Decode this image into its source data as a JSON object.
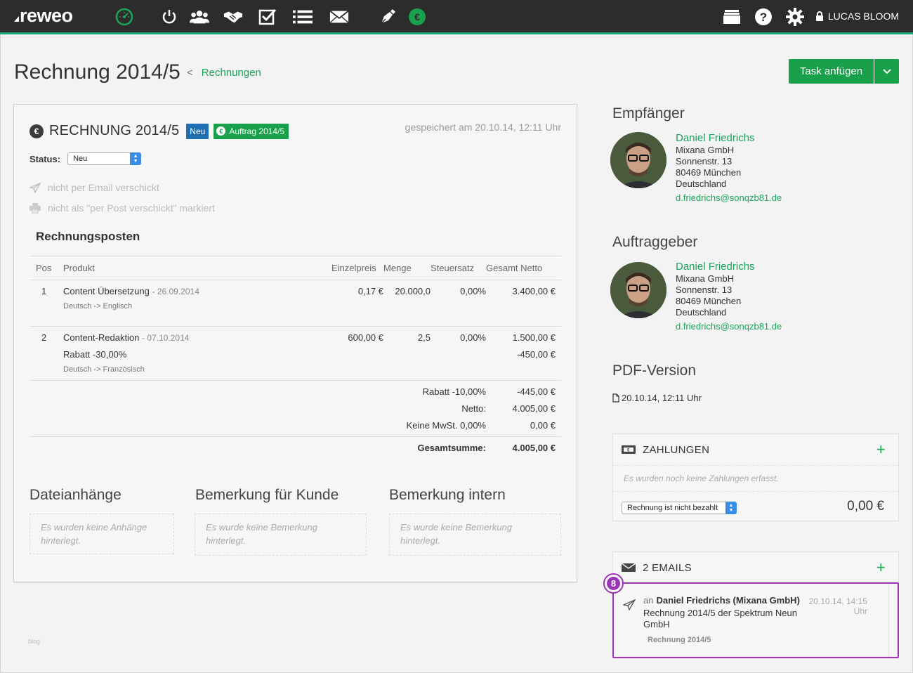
{
  "app": {
    "logo": "reweo",
    "user": "LUCAS BLOOM"
  },
  "nav": {
    "icons": [
      "dashboard-icon",
      "power-icon",
      "contacts-icon",
      "deals-icon",
      "tasks-icon",
      "list-icon",
      "mail-icon",
      "pen-icon",
      "finance-icon"
    ],
    "right_icons": [
      "archive-icon",
      "help-icon",
      "settings-icon",
      "lock-icon"
    ],
    "accent": "#1aa878"
  },
  "header": {
    "title": "Rechnung 2014/5",
    "breadcrumb": "Rechnungen",
    "task_button": "Task anfügen"
  },
  "invoice": {
    "title": "RECHNUNG 2014/5",
    "badge_status": "Neu",
    "badge_order": "Auftrag 2014/5",
    "saved": "gespeichert am 20.10.14, 12:11 Uhr",
    "status_label": "Status:",
    "status_value": "Neu",
    "email_state": "nicht per Email verschickt",
    "post_state": "nicht als \"per Post verschickt\" markiert",
    "section_title": "Rechnungsposten",
    "columns": [
      "Pos",
      "Produkt",
      "Einzelpreis",
      "Menge",
      "Steuersatz",
      "Gesamt Netto"
    ],
    "rows": [
      {
        "pos": "1",
        "product": "Content Übersetzung",
        "date": "- 26.09.2014",
        "price": "0,17 €",
        "qty": "20.000,0",
        "tax": "0,00%",
        "total": "3.400,00 €",
        "discount_label": "",
        "discount_value": "",
        "note": "Deutsch -> Englisch"
      },
      {
        "pos": "2",
        "product": "Content-Redaktion",
        "date": "- 07.10.2014",
        "price": "600,00 €",
        "qty": "2,5",
        "tax": "0,00%",
        "total": "1.500,00 €",
        "discount_label": "Rabatt -30,00%",
        "discount_value": "-450,00 €",
        "note": "Deutsch -> Französisch"
      }
    ],
    "totals": [
      {
        "label": "Rabatt -10,00%",
        "value": "-445,00 €"
      },
      {
        "label": "Netto:",
        "value": "4.005,00 €"
      },
      {
        "label": "Keine MwSt. 0,00%",
        "value": "0,00 €"
      }
    ],
    "sum_label": "Gesamtsumme:",
    "sum_value": "4.005,00 €"
  },
  "bottom": {
    "attachments_title": "Dateianhänge",
    "attachments_empty": "Es wurden keine Anhänge hinterlegt.",
    "customer_note_title": "Bemerkung für Kunde",
    "customer_note_empty": "Es wurde keine Bemerkung hinterlegt.",
    "internal_note_title": "Bemerkung intern",
    "internal_note_empty": "Es wurde keine Bemerkung hinterlegt.",
    "footer_tiny": "blog"
  },
  "recipient": {
    "title": "Empfänger",
    "name": "Daniel Friedrichs",
    "company": "Mixana GmbH",
    "street": "Sonnenstr. 13",
    "city": "80469 München",
    "country": "Deutschland",
    "email": "d.friedrichs@sonqzb81.de"
  },
  "client": {
    "title": "Auftraggeber",
    "name": "Daniel Friedrichs",
    "company": "Mixana GmbH",
    "street": "Sonnenstr. 13",
    "city": "80469 München",
    "country": "Deutschland",
    "email": "d.friedrichs@sonqzb81.de"
  },
  "pdf": {
    "title": "PDF-Version",
    "file": "20.10.14, 12:11 Uhr"
  },
  "payments": {
    "title": "ZAHLUNGEN",
    "empty": "Es wurden noch keine Zahlungen erfasst.",
    "status": "Rechnung ist nicht bezahlt",
    "amount": "0,00 €"
  },
  "emails": {
    "title": "2 EMAILS",
    "step": "8",
    "to_prefix": "an",
    "to": "Daniel Friedrichs (Mixana GmbH)",
    "subject": "Rechnung 2014/5 der Spektrum Neun GmbH",
    "tag": "Rechnung 2014/5",
    "time": "20.10.14, 14:15 Uhr"
  }
}
